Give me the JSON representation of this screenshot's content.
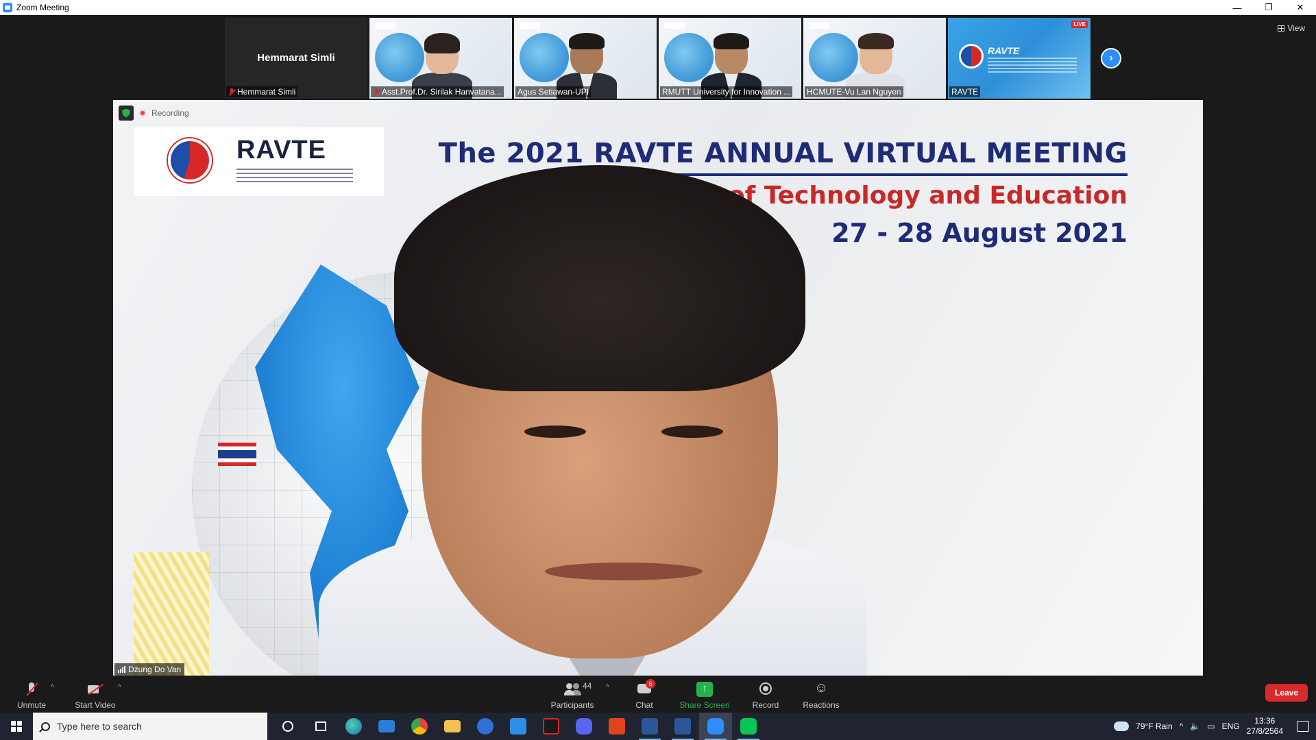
{
  "window": {
    "title": "Zoom Meeting",
    "minimize": "—",
    "restore": "❐",
    "close": "✕"
  },
  "thumbnails": [
    {
      "name": "Hemmarat Simli",
      "label": "Hemmarat Simli",
      "video": false,
      "muted": true
    },
    {
      "label": "Asst.Prof.Dr. Sirilak Hanvatana...",
      "video": true,
      "muted": true
    },
    {
      "label": "Agus Setiawan-UPI",
      "video": true,
      "muted": false
    },
    {
      "label": "RMUTT University for Innovation ...",
      "video": true,
      "muted": false
    },
    {
      "label": "HCMUTE-Vu Lan Nguyen",
      "video": true,
      "muted": false
    },
    {
      "label": "RAVTE",
      "video": true,
      "muted": false,
      "live": "LIVE",
      "logo_text": "RAVTE"
    }
  ],
  "view_button": "View",
  "recording": {
    "label": "Recording"
  },
  "stage": {
    "speaker_name": "Dzung Do Van",
    "logo_text": "RAVTE",
    "banner_line1": "The 2021 RAVTE ANNUAL VIRTUAL MEETING",
    "banner_line2": "University of Technology and Education",
    "banner_line3": "27 - 28 August 2021"
  },
  "toolbar": {
    "unmute": "Unmute",
    "start_video": "Start Video",
    "participants": "Participants",
    "participants_count": "44",
    "chat": "Chat",
    "chat_badge": "6",
    "share_screen": "Share Screen",
    "record": "Record",
    "reactions": "Reactions",
    "leave": "Leave",
    "caret": "^"
  },
  "taskbar": {
    "search_placeholder": "Type here to search",
    "weather": "79°F  Rain",
    "language": "ENG",
    "time": "13:36",
    "date": "27/8/2564"
  },
  "colors": {
    "zoom_blue": "#2d8cff",
    "share_green": "#24b24b",
    "leave_red": "#d8292c"
  }
}
